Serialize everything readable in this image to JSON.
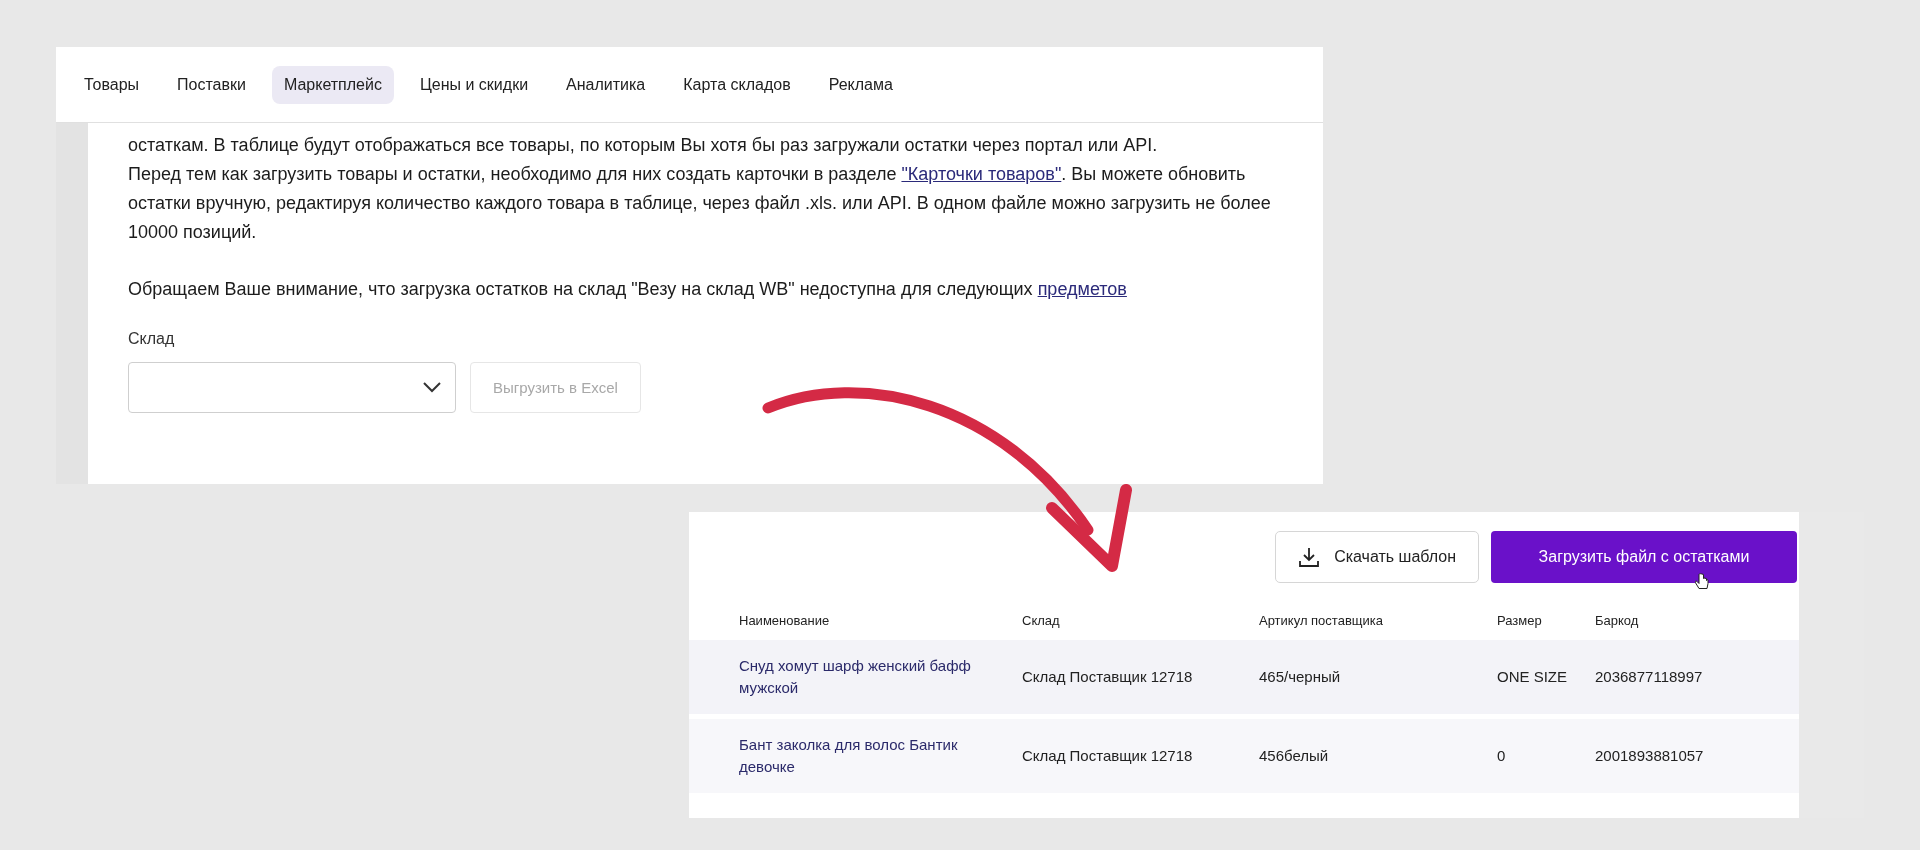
{
  "tabs": [
    {
      "label": "Товары",
      "selected": false
    },
    {
      "label": "Поставки",
      "selected": false
    },
    {
      "label": "Маркетплейс",
      "selected": true
    },
    {
      "label": "Цены и скидки",
      "selected": false
    },
    {
      "label": "Аналитика",
      "selected": false
    },
    {
      "label": "Карта складов",
      "selected": false
    },
    {
      "label": "Реклама",
      "selected": false
    }
  ],
  "notice": [
    {
      "parts": [
        {
          "kind": "text",
          "text": "остаткам. В таблице будут отображаться все товары, по которым Вы хотя бы раз загружали остатки через портал или API."
        }
      ]
    },
    {
      "parts": [
        {
          "kind": "text",
          "text": "Перед тем как загрузить товары и остатки, необходимо для них создать карточки в разделе "
        },
        {
          "kind": "link",
          "text": "\"Карточки товаров\""
        },
        {
          "kind": "text",
          "text": ". Вы можете обновить остатки вручную, редактируя количество каждого товара в таблице, через файл .xls. или API. В одном файле можно загрузить не более 10000 позиций."
        }
      ]
    },
    {
      "parts": [
        {
          "kind": "text",
          "text": "Обращаем Ваше внимание, что загрузка остатков на склад \"Везу на склад WB\" недоступна для следующих "
        },
        {
          "kind": "link",
          "text": "предметов"
        }
      ]
    }
  ],
  "warehouse_field": {
    "label": "Склад"
  },
  "export_button": {
    "label": "Выгрузить в Excel",
    "disabled": true
  },
  "actions": {
    "download_template": "Скачать шаблон",
    "upload": "Загрузить файл с остатками"
  },
  "table": {
    "columns": [
      "Наименование",
      "Склад",
      "Артикул поставщика",
      "Размер",
      "Баркод"
    ],
    "rows": [
      {
        "cells": [
          "Снуд хомут шарф женский бафф мужской",
          "Склад Поставщик 12718",
          "465/черный",
          "ONE SIZE",
          "2036877118997"
        ]
      },
      {
        "cells": [
          "Бант заколка для волос Бантик девочке",
          "Склад Поставщик 12718",
          "456белый",
          "0",
          "2001893881057"
        ]
      }
    ]
  }
}
